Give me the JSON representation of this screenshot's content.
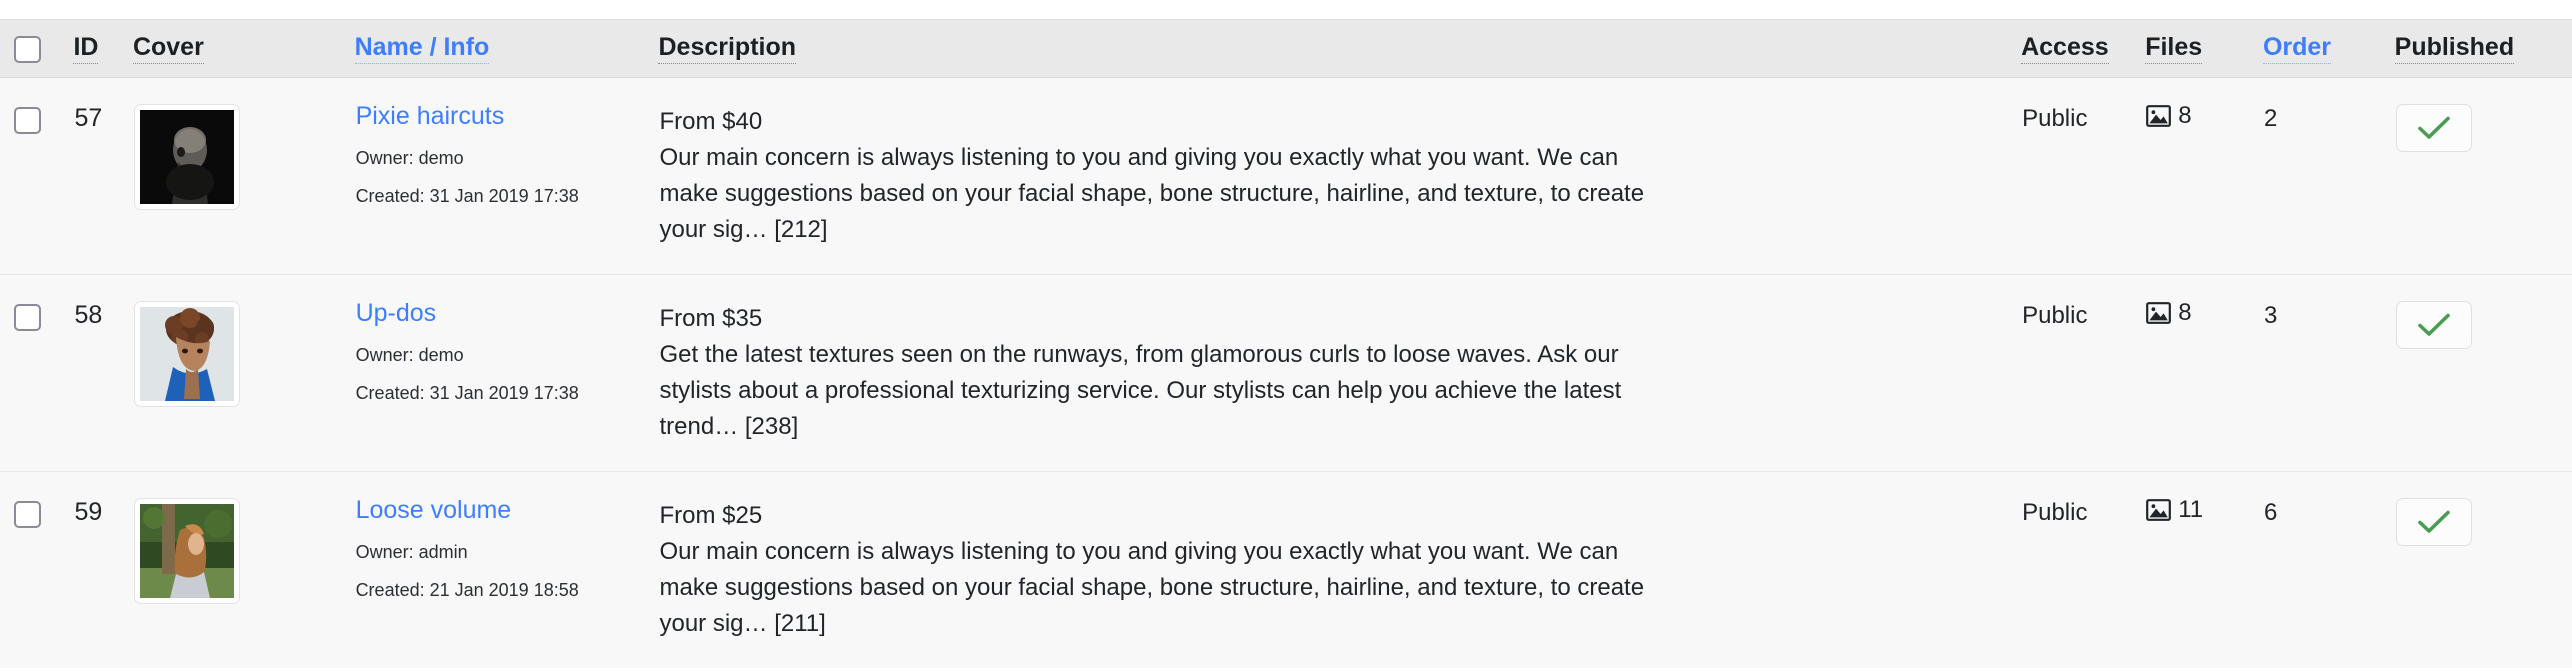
{
  "table": {
    "columns": [
      {
        "key": "select",
        "label": "",
        "sortable": false,
        "active": false
      },
      {
        "key": "id",
        "label": "ID",
        "sortable": true,
        "active": false
      },
      {
        "key": "cover",
        "label": "Cover",
        "sortable": true,
        "active": false
      },
      {
        "key": "name",
        "label": "Name / Info",
        "sortable": true,
        "active": true
      },
      {
        "key": "desc",
        "label": "Description",
        "sortable": true,
        "active": false
      },
      {
        "key": "access",
        "label": "Access",
        "sortable": true,
        "active": false
      },
      {
        "key": "files",
        "label": "Files",
        "sortable": true,
        "active": false
      },
      {
        "key": "order",
        "label": "Order",
        "sortable": true,
        "active": true
      },
      {
        "key": "published",
        "label": "Published",
        "sortable": true,
        "active": false
      }
    ],
    "select_all_checked": false,
    "rows": [
      {
        "selected": false,
        "id": "57",
        "cover_alt": "Pixie haircuts cover",
        "cover_theme": "dark-portrait",
        "name": "Pixie haircuts",
        "owner": "Owner: demo",
        "created": "Created: 31 Jan 2019 17:38",
        "price": "From $40",
        "description": "Our main concern is always listening to you and giving you exactly what you want. We can make suggestions based on your facial shape, bone structure, hairline, and texture, to create your sig… [212]",
        "access": "Public",
        "files_icon": "picture-icon",
        "files": "8",
        "order": "2",
        "published": true,
        "published_icon": "check-icon"
      },
      {
        "selected": false,
        "id": "58",
        "cover_alt": "Up-dos cover",
        "cover_theme": "curly-portrait",
        "name": "Up-dos",
        "owner": "Owner: demo",
        "created": "Created: 31 Jan 2019 17:38",
        "price": "From $35",
        "description": "Get the latest textures seen on the runways, from glamorous curls to loose waves. Ask our stylists about a professional texturizing service. Our stylists can help you achieve the latest trend… [238]",
        "access": "Public",
        "files_icon": "picture-icon",
        "files": "8",
        "order": "3",
        "published": true,
        "published_icon": "check-icon"
      },
      {
        "selected": false,
        "id": "59",
        "cover_alt": "Loose volume cover",
        "cover_theme": "outdoor-portrait",
        "name": "Loose volume",
        "owner": "Owner: admin",
        "created": "Created: 21 Jan 2019 18:58",
        "price": "From $25",
        "description": "Our main concern is always listening to you and giving you exactly what you want. We can make suggestions based on your facial shape, bone structure, hairline, and texture, to create your sig… [211]",
        "access": "Public",
        "files_icon": "picture-icon",
        "files": "11",
        "order": "6",
        "published": true,
        "published_icon": "check-icon"
      }
    ]
  },
  "colors": {
    "link": "#3d7eff",
    "header_bg": "#e9e9ea",
    "row_bg": "#f8f8f9",
    "check_green": "#4a9c52",
    "checkbox_border": "#8b8b98"
  }
}
